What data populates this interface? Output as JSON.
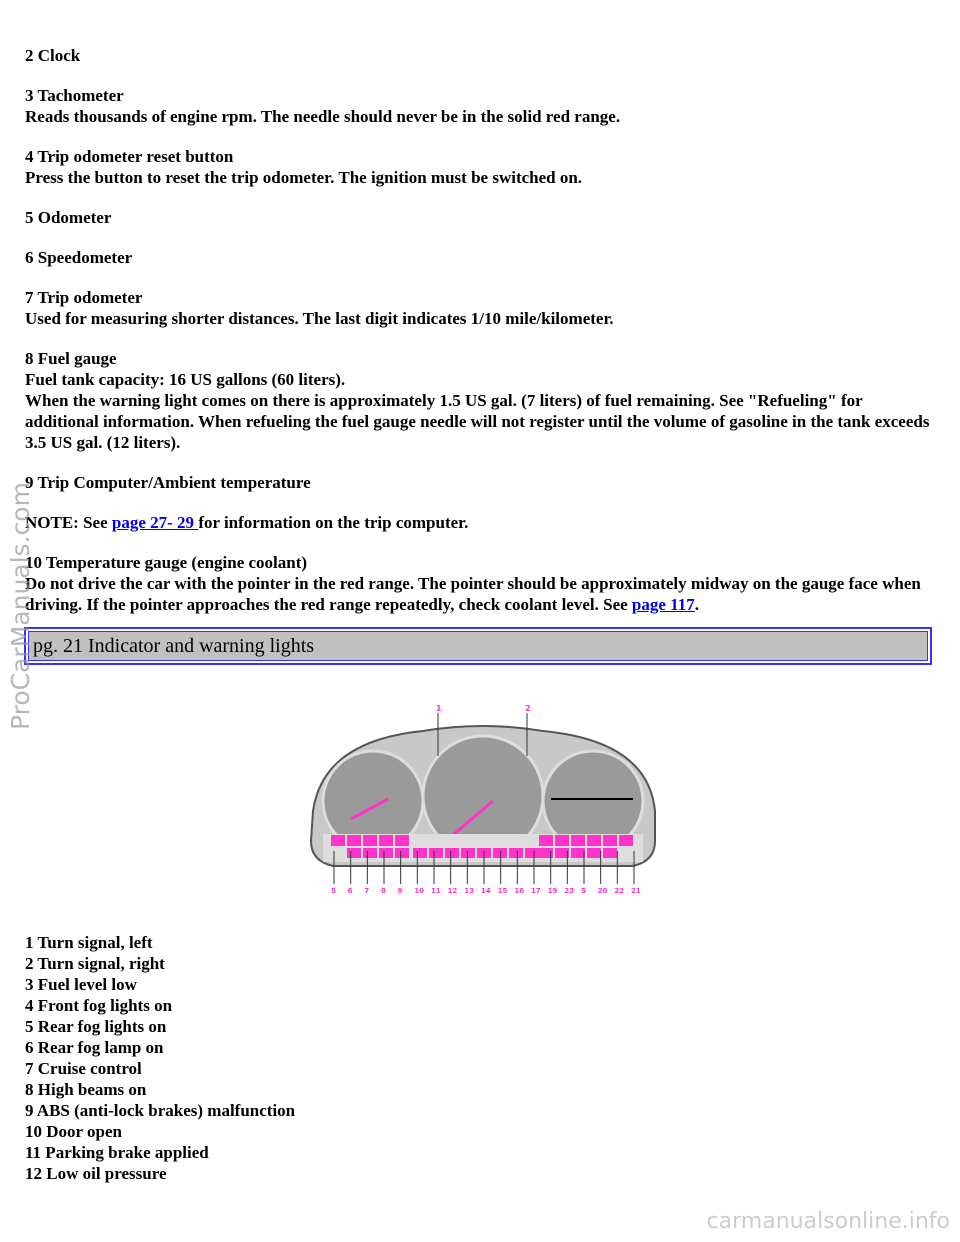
{
  "sections": [
    {
      "title": "2 Clock",
      "body": ""
    },
    {
      "title": "3 Tachometer",
      "body": "Reads thousands of engine rpm. The needle should never be in the solid red range."
    },
    {
      "title": "4 Trip odometer reset button",
      "body": "Press the button to reset the trip odometer. The ignition must be switched on."
    },
    {
      "title": "5 Odometer",
      "body": ""
    },
    {
      "title": "6 Speedometer",
      "body": ""
    },
    {
      "title": "7 Trip odometer",
      "body": "Used for measuring shorter distances. The last digit indicates 1/10 mile/kilometer."
    },
    {
      "title": "8 Fuel gauge",
      "body": "Fuel tank capacity: 16 US gallons (60 liters).",
      "body2": "When the warning light comes on there is approximately 1.5 US gal. (7 liters) of fuel remaining. See \"Refueling\" for additional information. When refueling the fuel gauge needle will not register until the volume of gasoline in the tank exceeds 3.5 US gal. (12 liters)."
    },
    {
      "title": "9 Trip Computer/Ambient temperature",
      "body": ""
    }
  ],
  "note": {
    "prefix": "NOTE: See ",
    "link": "page 27- 29 ",
    "suffix": "for information on the trip computer."
  },
  "temp": {
    "title": "10 Temperature gauge (engine coolant)",
    "body": "Do not drive the car with the pointer in the red range. The pointer should be approximately midway on the gauge face when driving. If the pointer approaches the red range repeatedly, check coolant level. See ",
    "link": "page 117",
    "end": "."
  },
  "header": "pg. 21 Indicator and warning lights",
  "figure": {
    "callouts_top": [
      "1",
      "2"
    ],
    "callouts_bottom": [
      "5",
      "6",
      "7",
      "8",
      "9",
      "10",
      "11",
      "12",
      "13",
      "14",
      "15",
      "16",
      "17",
      "19",
      "23",
      "5",
      "20",
      "22",
      "21"
    ],
    "accent": "#ff33cc"
  },
  "items": [
    "1 Turn signal, left",
    "2 Turn signal, right",
    "3 Fuel level low",
    "4 Front fog lights on",
    "5 Rear fog lights on",
    "6 Rear fog lamp on",
    "7 Cruise control",
    "8 High beams on",
    "9 ABS (anti-lock brakes) malfunction",
    "10 Door open",
    "11 Parking brake applied",
    "12 Low oil pressure"
  ],
  "watermark": "ProCarManuals.com",
  "footer": "carmanualsonline.info"
}
